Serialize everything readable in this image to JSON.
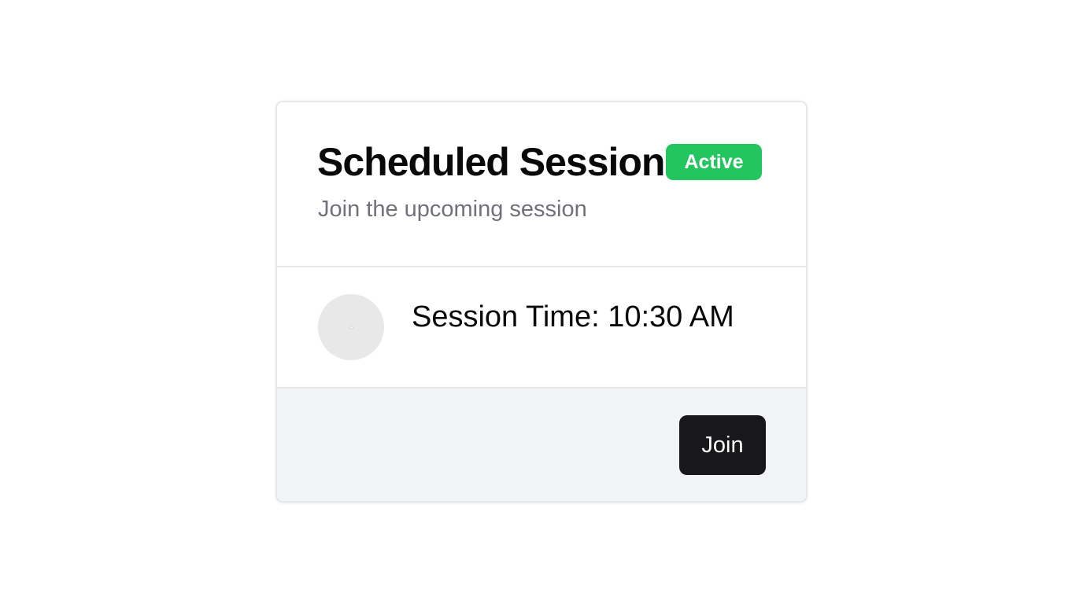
{
  "card": {
    "title": "Scheduled Session",
    "status_badge": "Active",
    "subtitle": "Join the upcoming session",
    "session_time": "Session Time: 10:30 AM",
    "join_button_label": "Join"
  },
  "colors": {
    "badge_active": "#22c55e",
    "button_primary": "#18181b",
    "footer_background": "#f2f3f5",
    "muted_text": "#71717a"
  },
  "icons": {
    "avatar": "avatar-placeholder-icon"
  }
}
